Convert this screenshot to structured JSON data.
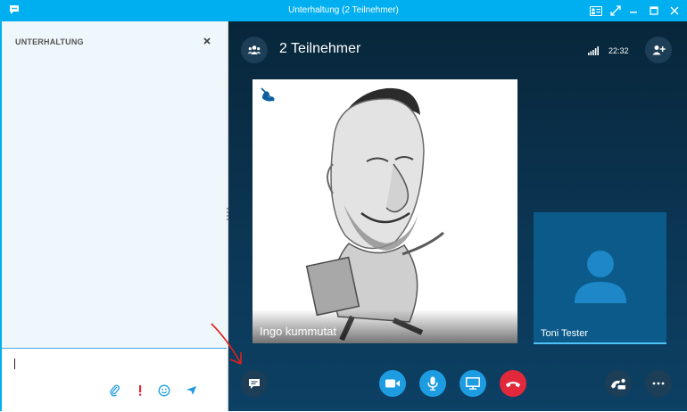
{
  "window": {
    "title": "Unterhaltung (2 Teilnehmer)",
    "accent": "#00aff0"
  },
  "conversation_pane": {
    "header": "UNTERHALTUNG",
    "compose_icons": [
      "attach-icon",
      "important-icon",
      "emoticon-icon",
      "send-icon"
    ]
  },
  "call": {
    "participants_label": "2 Teilnehmer",
    "time": "22:32",
    "main_participant": "Ingo kummutat",
    "self_participant": "Toni Tester",
    "controls": [
      "chat-icon",
      "video-icon",
      "microphone-icon",
      "present-screen-icon",
      "hang-up-icon",
      "call-controls-icon",
      "more-options-icon"
    ],
    "hangup_color": "#e2283b",
    "control_color": "#1e9ce1"
  }
}
